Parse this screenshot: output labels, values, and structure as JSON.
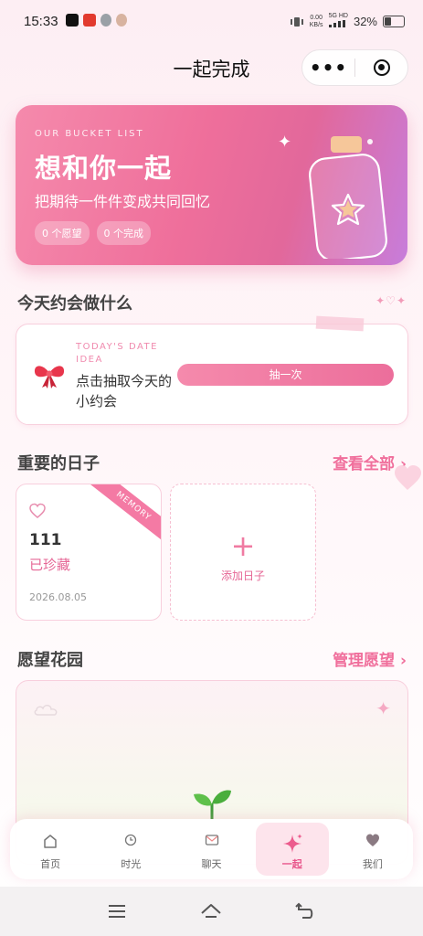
{
  "status": {
    "time": "15:33",
    "net_speed_value": "0.00",
    "net_speed_unit": "KB/s",
    "signal": "5G HD",
    "battery": "32%"
  },
  "titlebar": {
    "title": "一起完成",
    "more_glyph": "•••"
  },
  "hero": {
    "eyebrow": "OUR BUCKET LIST",
    "headline": "想和你一起",
    "subtitle": "把期待一件件变成共同回忆",
    "wish_count": "0 个愿望",
    "done_count": "0 个完成",
    "colors": {
      "start": "#f58aac",
      "end": "#c77ddb"
    }
  },
  "today": {
    "heading": "今天约会做什么",
    "decoration": "✦♡✦",
    "eyebrow": "TODAY'S DATE IDEA",
    "prompt": "点击抽取今天的小约会",
    "draw_button": "抽一次"
  },
  "days": {
    "heading": "重要的日子",
    "view_all": "查看全部",
    "chevron": "›",
    "card": {
      "ribbon": "MEMORY",
      "name": "111",
      "state": "已珍藏",
      "date": "2026.08.05"
    },
    "add_label": "添加日子",
    "add_glyph": "+"
  },
  "garden": {
    "heading": "愿望花园",
    "manage": "管理愿望",
    "chevron": "›"
  },
  "tabs": [
    {
      "label": "首页",
      "icon": "home-icon"
    },
    {
      "label": "时光",
      "icon": "clock-icon"
    },
    {
      "label": "聊天",
      "icon": "chat-icon"
    },
    {
      "label": "一起",
      "icon": "sparkle-icon",
      "active": true
    },
    {
      "label": "我们",
      "icon": "heart-icon"
    }
  ],
  "accent": "#ec6e9b"
}
